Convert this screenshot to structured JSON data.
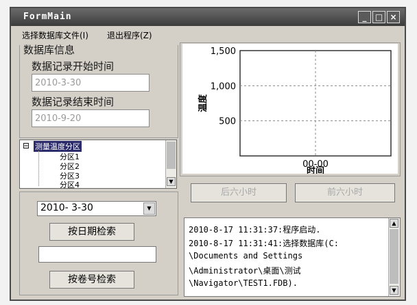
{
  "window": {
    "title": "FormMain",
    "min_glyph": "_",
    "max_glyph": "□",
    "close_glyph": "×"
  },
  "menu": {
    "items": [
      "选择数据库文件(I)",
      "退出程序(Z)"
    ]
  },
  "db_info": {
    "group_label": "数据库信息",
    "start_label": "数据记录开始时间",
    "start_value": "2010-3-30",
    "end_label": "数据记录结束时间",
    "end_value": "2010-9-20"
  },
  "tree": {
    "root": "测量温度分区",
    "expander": "⊟",
    "children": [
      "分区1",
      "分区2",
      "分区3",
      "分区4"
    ]
  },
  "search": {
    "date_value": "2010- 3-30",
    "date_button": "按日期检索",
    "volume_value": "",
    "volume_button": "按卷号检索"
  },
  "nav": {
    "prev_button": "后六小时",
    "next_button": "前六小时"
  },
  "log": {
    "lines": [
      "2010-8-17 11:31:37:程序启动.",
      "2010-8-17 11:31:41:选择数据库(C:",
      "\\Documents and Settings",
      "\\Administrator\\桌面\\测试",
      "\\Navigator\\TEST1.FDB)."
    ]
  },
  "chart_data": {
    "type": "line",
    "ylabel": "温度",
    "xlabel": "时间",
    "ylim": [
      0,
      1500
    ],
    "yticks": [
      "500",
      "1,000",
      "1,500"
    ],
    "xticks": [
      "00-00"
    ],
    "grid": true,
    "series": []
  }
}
